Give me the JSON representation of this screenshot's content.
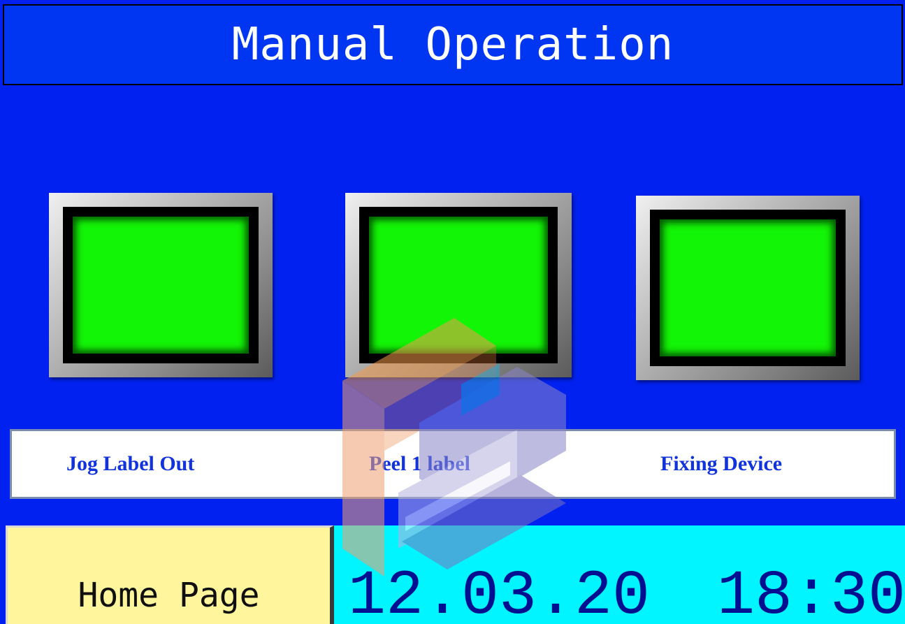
{
  "title": "Manual Operation",
  "buttons": [
    {
      "label": "Jog Label Out"
    },
    {
      "label": "Peel 1 label"
    },
    {
      "label": "Fixing Device"
    }
  ],
  "footer": {
    "home_label": "Home Page",
    "date": "12.03.20",
    "time": "18:30"
  },
  "colors": {
    "background": "#0021ef",
    "title_bar": "#0036f2",
    "lamp_green": "#13f506",
    "label_text": "#1133dd",
    "home_button": "#fff59c",
    "clock_panel": "#00f5ff"
  }
}
